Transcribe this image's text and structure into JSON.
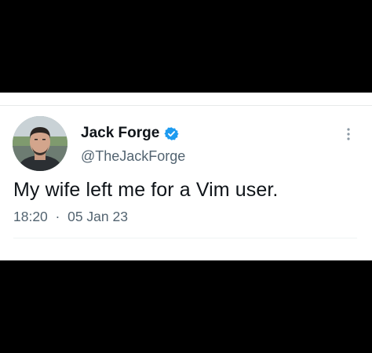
{
  "tweet": {
    "author": {
      "display_name": "Jack Forge",
      "handle": "@TheJackForge",
      "verified": true
    },
    "text": "My wife left me for a Vim user.",
    "time": "18:20",
    "separator": "·",
    "date": "05 Jan 23"
  },
  "icons": {
    "avatar": "avatar-photo",
    "verified": "verified-badge-icon",
    "more": "more-options-icon"
  },
  "colors": {
    "background": "#000000",
    "card": "#ffffff",
    "primary_text": "#0f1419",
    "secondary_text": "#536471",
    "verified_blue": "#1d9bf0",
    "divider": "#eff3f4"
  }
}
